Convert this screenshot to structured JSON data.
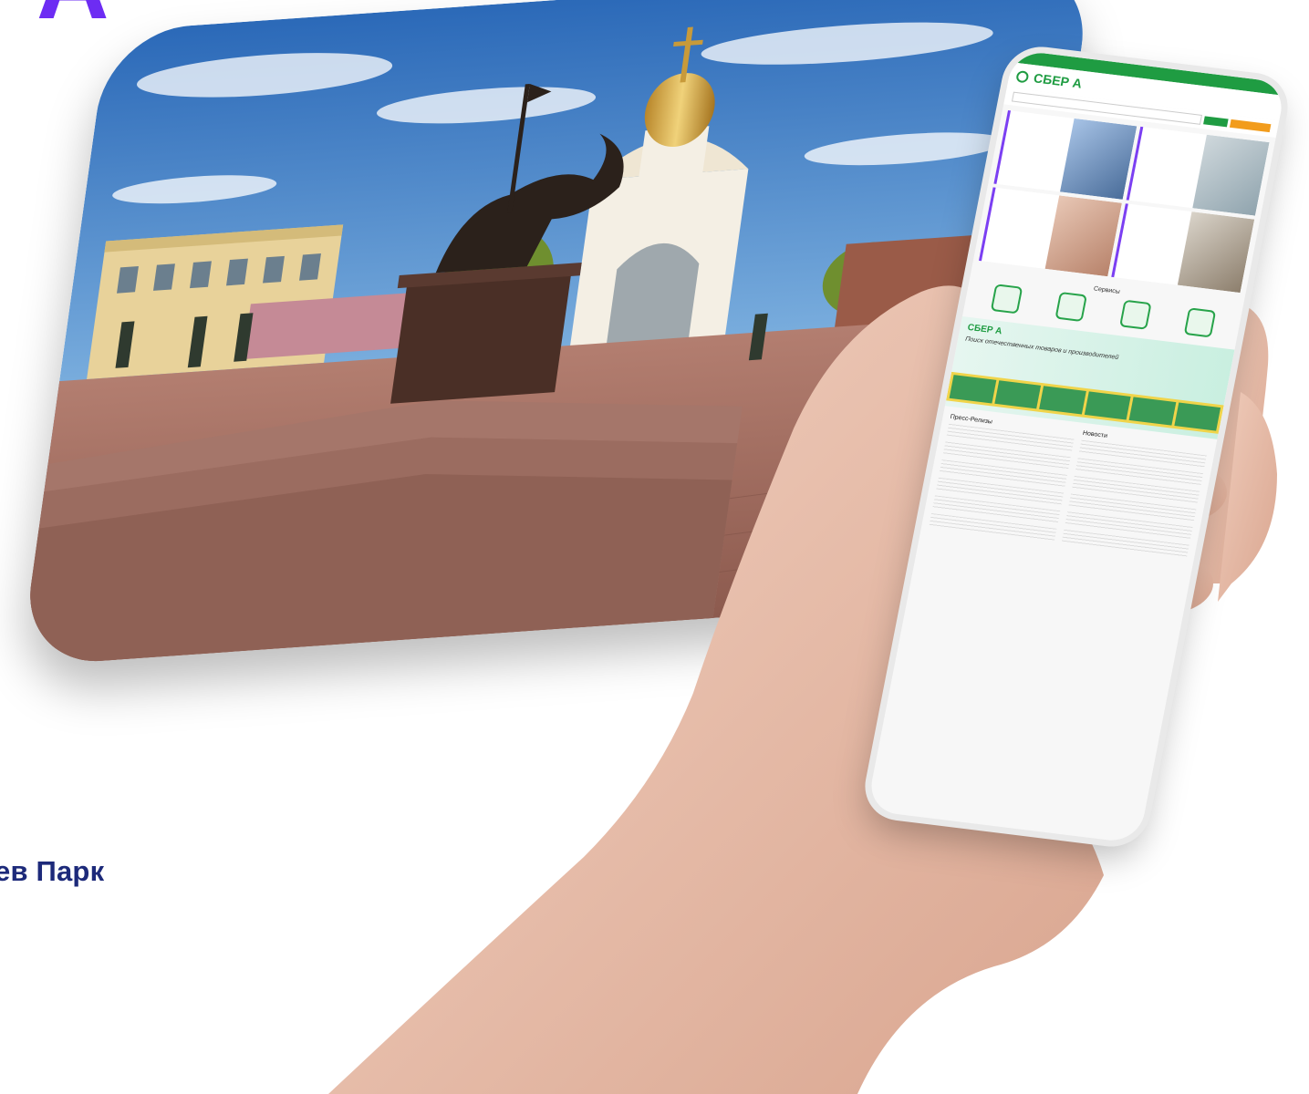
{
  "brand_letter": "А",
  "caption": "ев Парк",
  "phone": {
    "logo": "СБЕР А",
    "services_title": "Сервисы",
    "banner_title": "СБЕР А",
    "banner_sub": "Поиск отечественных товаров и производителей",
    "col_left_title": "Пресс-Релизы",
    "col_right_title": "Новости"
  },
  "colors": {
    "accent": "#6d2cf3",
    "caption": "#1d2a7a",
    "sber_green": "#1f9c42"
  }
}
